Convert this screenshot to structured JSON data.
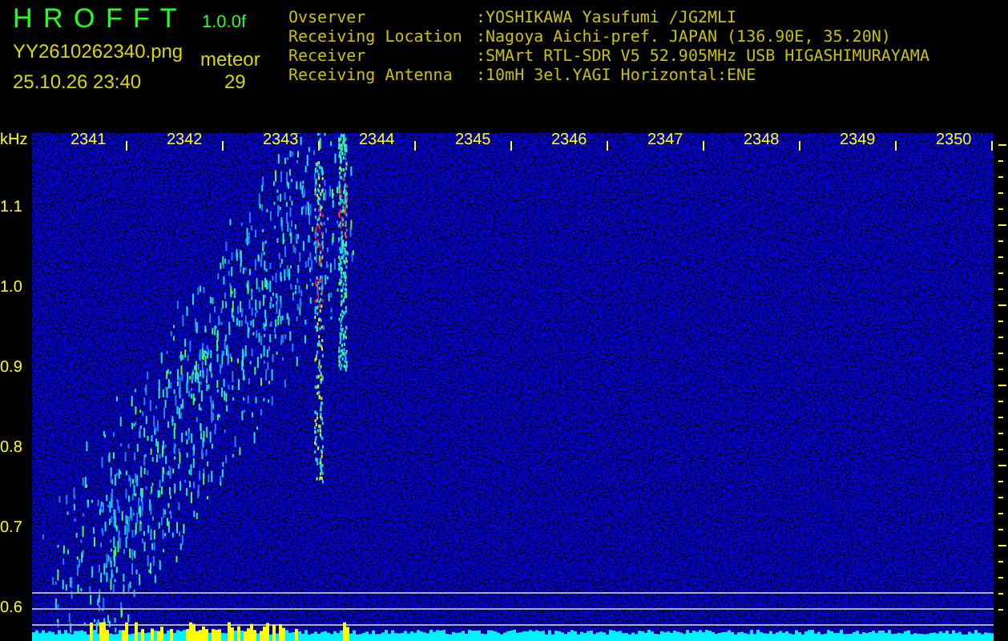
{
  "header": {
    "app_name": "H R O F F T",
    "version": "1.0.0f",
    "file_name": "YY2610262340.png",
    "counter_label": "meteor",
    "timestamp": "25.10.26 23:40",
    "counter_value": "29"
  },
  "station_info": [
    {
      "label": "Ovserver",
      "value": ":YOSHIKAWA Yasufumi /JG2MLI"
    },
    {
      "label": "Receiving Location",
      "value": ":Nagoya Aichi-pref. JAPAN (136.90E, 35.20N)"
    },
    {
      "label": "Receiver",
      "value": ":SMArt RTL-SDR V5 52.905MHz USB HIGASHIMURAYAMA"
    },
    {
      "label": "Receiving Antenna",
      "value": ":10mH 3el.YAGI Horizontal:ENE"
    }
  ],
  "spectrogram": {
    "y_unit": "kHz",
    "y_labels": [
      "1.1",
      "1.0",
      "0.9",
      "0.8",
      "0.7",
      "0.6"
    ],
    "x_labels": [
      "2341",
      "2342",
      "2343",
      "2344",
      "2345",
      "2346",
      "2347",
      "2348",
      "2349",
      "2350"
    ]
  }
}
